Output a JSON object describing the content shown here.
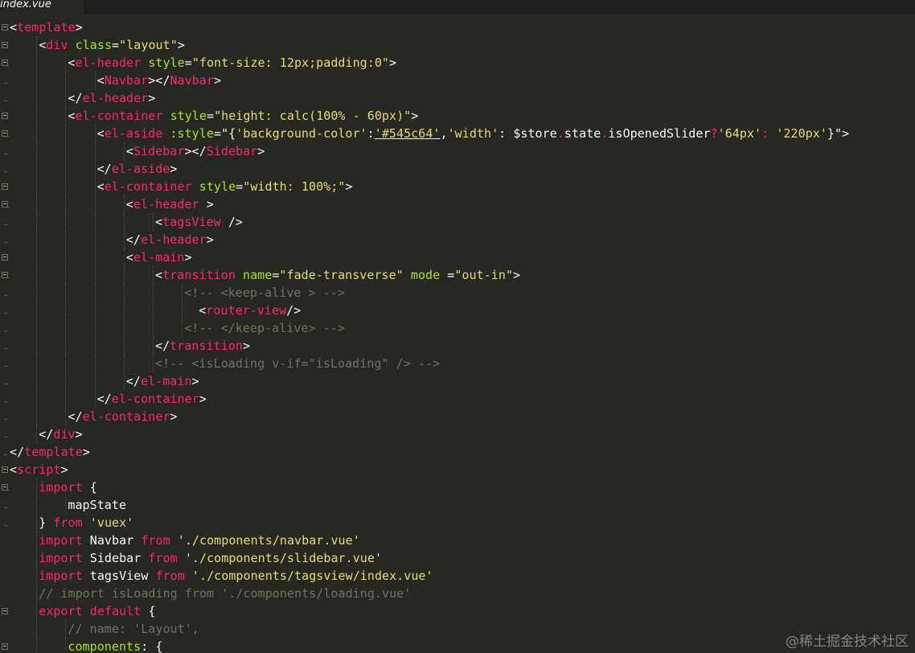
{
  "tab": {
    "title": "index.vue"
  },
  "watermark": "@稀土掘金技术社区",
  "colors": {
    "background": "#272822",
    "tag": "#f92672",
    "attribute": "#a6e22e",
    "string": "#e6db74",
    "comment": "#75715e",
    "text": "#f8f8f2"
  },
  "lines": [
    {
      "fold": "box",
      "indent": 0,
      "tokens": [
        [
          "p",
          "<"
        ],
        [
          "tag",
          "template"
        ],
        [
          "p",
          ">"
        ]
      ]
    },
    {
      "fold": "box",
      "indent": 1,
      "tokens": [
        [
          "p",
          "<"
        ],
        [
          "tag",
          "div"
        ],
        [
          "p",
          " "
        ],
        [
          "attr",
          "class"
        ],
        [
          "p",
          "="
        ],
        [
          "str",
          "\"layout\""
        ],
        [
          "p",
          ">"
        ]
      ]
    },
    {
      "fold": "box",
      "indent": 2,
      "tokens": [
        [
          "p",
          "<"
        ],
        [
          "tag",
          "el-header"
        ],
        [
          "p",
          " "
        ],
        [
          "attr",
          "style"
        ],
        [
          "p",
          "="
        ],
        [
          "str",
          "\"font-size: 12px;padding:0\""
        ],
        [
          "p",
          ">"
        ]
      ]
    },
    {
      "fold": "tick",
      "indent": 3,
      "tokens": [
        [
          "p",
          "<"
        ],
        [
          "tag",
          "Navbar"
        ],
        [
          "p",
          "></"
        ],
        [
          "tag",
          "Navbar"
        ],
        [
          "p",
          ">"
        ]
      ]
    },
    {
      "fold": "tick",
      "indent": 2,
      "tokens": [
        [
          "p",
          "</"
        ],
        [
          "tag",
          "el-header"
        ],
        [
          "p",
          ">"
        ]
      ]
    },
    {
      "fold": "box",
      "indent": 2,
      "tokens": [
        [
          "p",
          "<"
        ],
        [
          "tag",
          "el-container"
        ],
        [
          "p",
          " "
        ],
        [
          "attr",
          "style"
        ],
        [
          "p",
          "="
        ],
        [
          "str",
          "\"height: calc(100% - 60px)\""
        ],
        [
          "p",
          ">"
        ]
      ]
    },
    {
      "fold": "box",
      "indent": 3,
      "tokens": [
        [
          "p",
          "<"
        ],
        [
          "tag",
          "el-aside"
        ],
        [
          "p",
          " "
        ],
        [
          "attr",
          ":style"
        ],
        [
          "p",
          "=\"{"
        ],
        [
          "str",
          "'background-color'"
        ],
        [
          "p",
          ":"
        ],
        [
          "str",
          "'#545c64'"
        ],
        [
          "p",
          ","
        ],
        [
          "str",
          "'width'"
        ],
        [
          "p",
          ": $store"
        ],
        [
          "op",
          "."
        ],
        [
          "p",
          "state"
        ],
        [
          "op",
          "."
        ],
        [
          "p",
          "isOpenedSlider"
        ],
        [
          "op",
          "?"
        ],
        [
          "str",
          "'64px'"
        ],
        [
          "op",
          ":"
        ],
        [
          "p",
          " "
        ],
        [
          "str",
          "'220px'"
        ],
        [
          "p",
          "}\">"
        ]
      ]
    },
    {
      "fold": "tick",
      "indent": 4,
      "tokens": [
        [
          "p",
          "<"
        ],
        [
          "tag",
          "Sidebar"
        ],
        [
          "p",
          "></"
        ],
        [
          "tag",
          "Sidebar"
        ],
        [
          "p",
          ">"
        ]
      ]
    },
    {
      "fold": "tick",
      "indent": 3,
      "tokens": [
        [
          "p",
          "</"
        ],
        [
          "tag",
          "el-aside"
        ],
        [
          "p",
          ">"
        ]
      ]
    },
    {
      "fold": "box",
      "indent": 3,
      "tokens": [
        [
          "p",
          "<"
        ],
        [
          "tag",
          "el-container"
        ],
        [
          "p",
          " "
        ],
        [
          "attr",
          "style"
        ],
        [
          "p",
          "="
        ],
        [
          "str",
          "\"width: 100%;\""
        ],
        [
          "p",
          ">"
        ]
      ]
    },
    {
      "fold": "box",
      "indent": 4,
      "tokens": [
        [
          "p",
          "<"
        ],
        [
          "tag",
          "el-header"
        ],
        [
          "p",
          " >"
        ]
      ]
    },
    {
      "fold": "tick",
      "indent": 5,
      "tokens": [
        [
          "p",
          "<"
        ],
        [
          "tag",
          "tagsView"
        ],
        [
          "p",
          " />"
        ]
      ]
    },
    {
      "fold": "tick",
      "indent": 4,
      "tokens": [
        [
          "p",
          "</"
        ],
        [
          "tag",
          "el-header"
        ],
        [
          "p",
          ">"
        ]
      ]
    },
    {
      "fold": "box",
      "indent": 4,
      "tokens": [
        [
          "p",
          "<"
        ],
        [
          "tag",
          "el-main"
        ],
        [
          "p",
          ">"
        ]
      ]
    },
    {
      "fold": "box",
      "indent": 5,
      "tokens": [
        [
          "p",
          "<"
        ],
        [
          "tag",
          "transition"
        ],
        [
          "p",
          " "
        ],
        [
          "attr",
          "name"
        ],
        [
          "p",
          "="
        ],
        [
          "str",
          "\"fade-transverse\""
        ],
        [
          "p",
          " "
        ],
        [
          "attr",
          "mode"
        ],
        [
          "p",
          " ="
        ],
        [
          "str",
          "\"out-in\""
        ],
        [
          "p",
          ">"
        ]
      ]
    },
    {
      "fold": "tick",
      "indent": 6,
      "tokens": [
        [
          "cmt",
          "<!-- <keep-alive > -->"
        ]
      ]
    },
    {
      "fold": "tick",
      "indent": 6,
      "extra": 1,
      "tokens": [
        [
          "p",
          "<"
        ],
        [
          "tag",
          "router-view"
        ],
        [
          "p",
          "/>"
        ]
      ]
    },
    {
      "fold": "tick",
      "indent": 6,
      "tokens": [
        [
          "cmt",
          "<!-- </keep-alive> -->"
        ]
      ]
    },
    {
      "fold": "tick",
      "indent": 5,
      "tokens": [
        [
          "p",
          "</"
        ],
        [
          "tag",
          "transition"
        ],
        [
          "p",
          ">"
        ]
      ]
    },
    {
      "fold": "tick",
      "indent": 5,
      "tokens": [
        [
          "cmt",
          "<!-- <isLoading v-if=\"isLoading\" /> -->"
        ]
      ]
    },
    {
      "fold": "tick",
      "indent": 4,
      "tokens": [
        [
          "p",
          "</"
        ],
        [
          "tag",
          "el-main"
        ],
        [
          "p",
          ">"
        ]
      ]
    },
    {
      "fold": "tick",
      "indent": 3,
      "tokens": [
        [
          "p",
          "</"
        ],
        [
          "tag",
          "el-container"
        ],
        [
          "p",
          ">"
        ]
      ]
    },
    {
      "fold": "tick",
      "indent": 2,
      "tokens": [
        [
          "p",
          "</"
        ],
        [
          "tag",
          "el-container"
        ],
        [
          "p",
          ">"
        ]
      ]
    },
    {
      "fold": "tick",
      "indent": 1,
      "tokens": [
        [
          "p",
          "</"
        ],
        [
          "tag",
          "div"
        ],
        [
          "p",
          ">"
        ]
      ]
    },
    {
      "fold": "tick",
      "indent": 0,
      "tokens": [
        [
          "p",
          "</"
        ],
        [
          "tag",
          "template"
        ],
        [
          "p",
          ">"
        ]
      ]
    },
    {
      "fold": "box",
      "indent": 0,
      "tokens": [
        [
          "p",
          "<"
        ],
        [
          "tag",
          "script"
        ],
        [
          "p",
          ">"
        ]
      ]
    },
    {
      "fold": "box",
      "indent": 1,
      "tokens": [
        [
          "kw",
          "import"
        ],
        [
          "p",
          " {"
        ]
      ]
    },
    {
      "fold": "tick",
      "indent": 2,
      "tokens": [
        [
          "p",
          "mapState"
        ]
      ]
    },
    {
      "fold": "tick",
      "indent": 1,
      "tokens": [
        [
          "p",
          "} "
        ],
        [
          "kw",
          "from"
        ],
        [
          "p",
          " "
        ],
        [
          "str",
          "'vuex'"
        ]
      ]
    },
    {
      "fold": "none",
      "indent": 1,
      "tokens": [
        [
          "kw",
          "import"
        ],
        [
          "p",
          " Navbar "
        ],
        [
          "kw",
          "from"
        ],
        [
          "p",
          " "
        ],
        [
          "str",
          "'./components/navbar.vue'"
        ]
      ]
    },
    {
      "fold": "none",
      "indent": 1,
      "tokens": [
        [
          "kw",
          "import"
        ],
        [
          "p",
          " Sidebar "
        ],
        [
          "kw",
          "from"
        ],
        [
          "p",
          " "
        ],
        [
          "str",
          "'./components/slidebar.vue'"
        ]
      ]
    },
    {
      "fold": "none",
      "indent": 1,
      "tokens": [
        [
          "kw",
          "import"
        ],
        [
          "p",
          " tagsView "
        ],
        [
          "kw",
          "from"
        ],
        [
          "p",
          " "
        ],
        [
          "str",
          "'./components/tagsview/index.vue'"
        ]
      ]
    },
    {
      "fold": "none",
      "indent": 1,
      "tokens": [
        [
          "cmt",
          "// import isLoading from './components/loading.vue'"
        ]
      ]
    },
    {
      "fold": "box",
      "indent": 1,
      "tokens": [
        [
          "kw",
          "export"
        ],
        [
          "p",
          " "
        ],
        [
          "kw",
          "default"
        ],
        [
          "p",
          " {"
        ]
      ]
    },
    {
      "fold": "none",
      "indent": 2,
      "tokens": [
        [
          "cmt",
          "// name: 'Layout',"
        ]
      ]
    },
    {
      "fold": "box",
      "indent": 2,
      "tokens": [
        [
          "attr",
          "components"
        ],
        [
          "p",
          ": {"
        ]
      ]
    }
  ]
}
